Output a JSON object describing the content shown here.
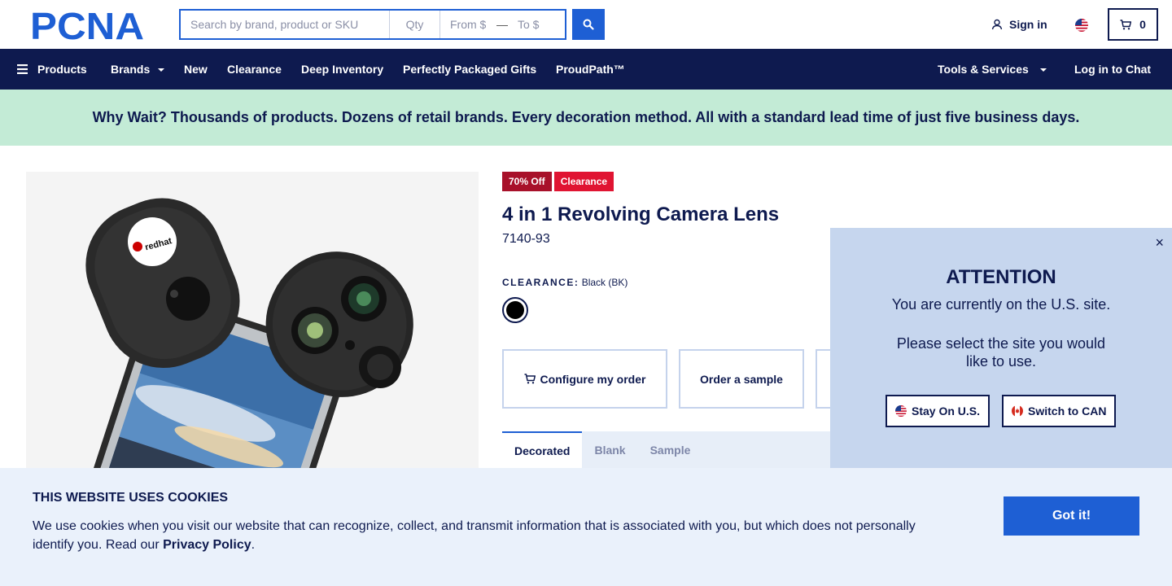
{
  "header": {
    "logo_text": "PCNA",
    "search": {
      "query_placeholder": "Search by brand, product or SKU",
      "qty_placeholder": "Qty",
      "from_placeholder": "From $",
      "dash": "—",
      "to_placeholder": "To $"
    },
    "sign_in": "Sign in",
    "cart_count": "0"
  },
  "nav": {
    "items": [
      "Products",
      "Brands",
      "New",
      "Clearance",
      "Deep Inventory",
      "Perfectly Packaged Gifts",
      "ProudPath™"
    ],
    "tools": "Tools & Services",
    "chat": "Log in to Chat"
  },
  "promo": "Why Wait? Thousands of products. Dozens of retail brands. Every decoration method. All with a standard lead time of just five business days.",
  "product": {
    "badges": [
      "70% Off",
      "Clearance"
    ],
    "title": "4 in 1 Revolving Camera Lens",
    "sku": "7140-93",
    "color_label": "CLEARANCE:",
    "color_value": "Black (BK)",
    "swatch_color": "#000000",
    "image_logo_text": "redhat",
    "actions": [
      "Configure my order",
      "Order a sample"
    ],
    "tabs": [
      "Decorated",
      "Blank",
      "Sample"
    ]
  },
  "region_modal": {
    "close": "×",
    "title": "ATTENTION",
    "message": "You are currently on the U.S. site.",
    "prompt": "Please select the site you would like to use.",
    "stay": "Stay On U.S.",
    "switch": "Switch to CAN"
  },
  "cookie": {
    "title": "THIS WEBSITE USES COOKIES",
    "text": "We use cookies when you visit our website that can recognize, collect, and transmit information that is associated with you, but which does not personally identify you. Read our ",
    "link": "Privacy Policy",
    "end": ".",
    "button": "Got it!"
  },
  "colors": {
    "navy": "#0e1a4f",
    "blue": "#1e5fd4",
    "promo_bg": "#c3ebd6",
    "clearance_red": "#e01432"
  }
}
